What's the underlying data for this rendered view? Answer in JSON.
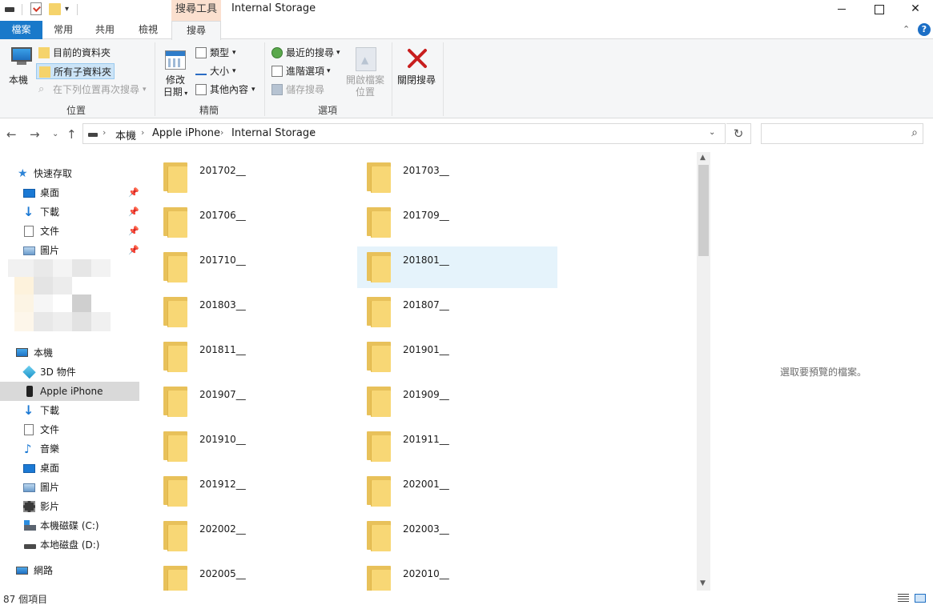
{
  "window": {
    "title": "Internal Storage",
    "context_tab_group": "搜尋工具"
  },
  "ribbon_tabs": {
    "file": "檔案",
    "home": "常用",
    "share": "共用",
    "view": "檢視",
    "search": "搜尋"
  },
  "ribbon": {
    "location": {
      "this_pc": "本機",
      "current_folder": "目前的資料夾",
      "all_subfolders": "所有子資料夾",
      "search_again": "在下列位置再次搜尋",
      "group_label": "位置"
    },
    "refine": {
      "date_modified_line1": "修改",
      "date_modified_line2": "日期",
      "kind": "類型",
      "size": "大小",
      "other_props": "其他內容",
      "group_label": "精簡"
    },
    "options": {
      "recent_searches": "最近的搜尋",
      "advanced_options": "進階選項",
      "save_search": "儲存搜尋",
      "open_location_line1": "開啟檔案",
      "open_location_line2": "位置",
      "group_label": "選項"
    },
    "close_search": "關閉搜尋"
  },
  "address": {
    "crumbs": [
      "本機",
      "Apple iPhone",
      "Internal Storage"
    ]
  },
  "navpane": {
    "quick_access": "快速存取",
    "quick_items": [
      "桌面",
      "下載",
      "文件",
      "圖片"
    ],
    "this_pc": "本機",
    "pc_items": [
      "3D 物件",
      "Apple iPhone",
      "下載",
      "文件",
      "音樂",
      "桌面",
      "圖片",
      "影片",
      "本機磁碟 (C:)",
      "本地磁盘 (D:)"
    ],
    "network": "網路",
    "selected": "Apple iPhone"
  },
  "folders": [
    "201702__",
    "201703__",
    "201706__",
    "201709__",
    "201710__",
    "201801__",
    "201803__",
    "201807__",
    "201811__",
    "201901__",
    "201907__",
    "201909__",
    "201910__",
    "201911__",
    "201912__",
    "202001__",
    "202002__",
    "202003__",
    "202005__",
    "202010__"
  ],
  "hovered_folder": "201801__",
  "preview": {
    "message": "選取要預覽的檔案。"
  },
  "status": {
    "item_count": "87 個項目"
  },
  "colors": {
    "file_tab": "#1979ca",
    "context_tab": "#fbe0cf",
    "folder": "#f8d775",
    "selection": "#cce4f7",
    "hover": "#e5f3fb"
  }
}
